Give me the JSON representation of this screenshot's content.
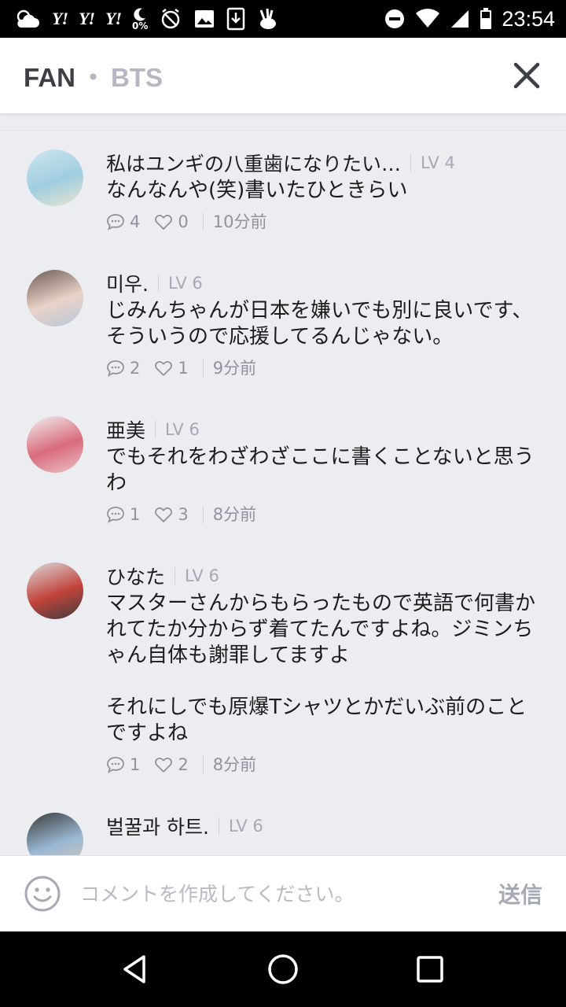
{
  "status_bar": {
    "yahoo_icons": [
      "Y!",
      "Y!",
      "Y!"
    ],
    "moon_pct": "0%",
    "time": "23:54"
  },
  "header": {
    "title_primary": "FAN",
    "title_separator": "・",
    "title_secondary": "BTS",
    "close_icon": "close-icon"
  },
  "comments": [
    {
      "name": "私はユンギの八重歯になりたい…",
      "level": "LV 4",
      "text": "なんなんや(笑)書いたひときらい",
      "reply_count": "4",
      "like_count": "0",
      "time": "10分前",
      "avatar_colors": [
        "#cfe6ee",
        "#9fcde0",
        "#e9e5d0"
      ]
    },
    {
      "name": "미우.",
      "level": "LV 6",
      "text": "じみんちゃんが日本を嫌いでも別に良いです、そういうので応援してるんじゃない。",
      "reply_count": "2",
      "like_count": "1",
      "time": "9分前",
      "avatar_colors": [
        "#6b5a52",
        "#e9d2c8",
        "#b7c8d8"
      ]
    },
    {
      "name": "亜美",
      "level": "LV 6",
      "text": "でもそれをわざわざここに書くことないと思うわ",
      "reply_count": "1",
      "like_count": "3",
      "time": "8分前",
      "avatar_colors": [
        "#f1f1f1",
        "#d96b7b",
        "#eac3c9"
      ]
    },
    {
      "name": "ひなた",
      "level": "LV 6",
      "text": "マスターさんからもらったもので英語で何書かれてたか分からず着てたんですよね。ジミンちゃん自体も謝罪してますよ\n\nそれにしでも原爆Tシャツとかだいぶ前のことですよね",
      "reply_count": "1",
      "like_count": "2",
      "time": "8分前",
      "avatar_colors": [
        "#dcdcdc",
        "#c2433b",
        "#3d3d3d"
      ]
    },
    {
      "name": "벌꿀과 하트.",
      "level": "LV 6",
      "text": "",
      "reply_count": "",
      "like_count": "",
      "time": "",
      "avatar_colors": [
        "#3a3a3a",
        "#9ab8d3",
        "#d8c7b8"
      ]
    }
  ],
  "comment_box": {
    "placeholder": "コメントを作成してください。",
    "send_label": "送信"
  },
  "icons": {
    "reply": "speech-bubble-icon",
    "like": "heart-outline-icon",
    "emoji": "smiley-icon",
    "back": "back-triangle-icon",
    "home": "home-circle-icon",
    "recents": "recents-square-icon"
  },
  "colors": {
    "background": "#ecedf1",
    "header_primary": "#3c3f46",
    "header_secondary": "#b4b8c2",
    "meta_text": "#8f939c"
  }
}
